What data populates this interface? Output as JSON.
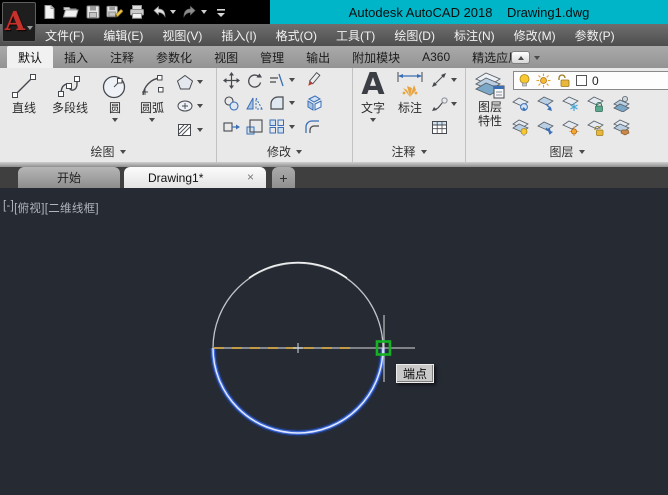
{
  "title_bar": {
    "app_title": "Autodesk AutoCAD 2018    Drawing1.dwg"
  },
  "menu": {
    "items": [
      "文件(F)",
      "编辑(E)",
      "视图(V)",
      "插入(I)",
      "格式(O)",
      "工具(T)",
      "绘图(D)",
      "标注(N)",
      "修改(M)",
      "参数(P)"
    ]
  },
  "ribbon": {
    "tabs": [
      "默认",
      "插入",
      "注释",
      "参数化",
      "视图",
      "管理",
      "输出",
      "附加模块",
      "A360",
      "精选应用"
    ],
    "draw": {
      "label": "绘图",
      "line": "直线",
      "polyline": "多段线",
      "circle": "圆",
      "arc": "圆弧"
    },
    "modify": {
      "label": "修改"
    },
    "annotate": {
      "label": "注释",
      "text": "文字",
      "text_icon": "A",
      "dimension": "标注"
    },
    "layers": {
      "label": "图层",
      "properties_line1": "图层",
      "properties_line2": "特性",
      "current_layer": "0"
    }
  },
  "file_tabs": {
    "start": "开始",
    "active": "Drawing1*",
    "close": "×",
    "new_tab": "+"
  },
  "viewport": {
    "pane_control": "[-]",
    "view_control": "[俯视]",
    "style_control": "[二维线框]"
  },
  "canvas": {
    "snap_tooltip": "端点"
  },
  "colors": {
    "titlebar_teal": "#00b5c8",
    "canvas_bg": "#252a33",
    "selection_blue": "#3c67d6",
    "dash_gold": "#cfa03c",
    "snap_green": "#15b224"
  }
}
